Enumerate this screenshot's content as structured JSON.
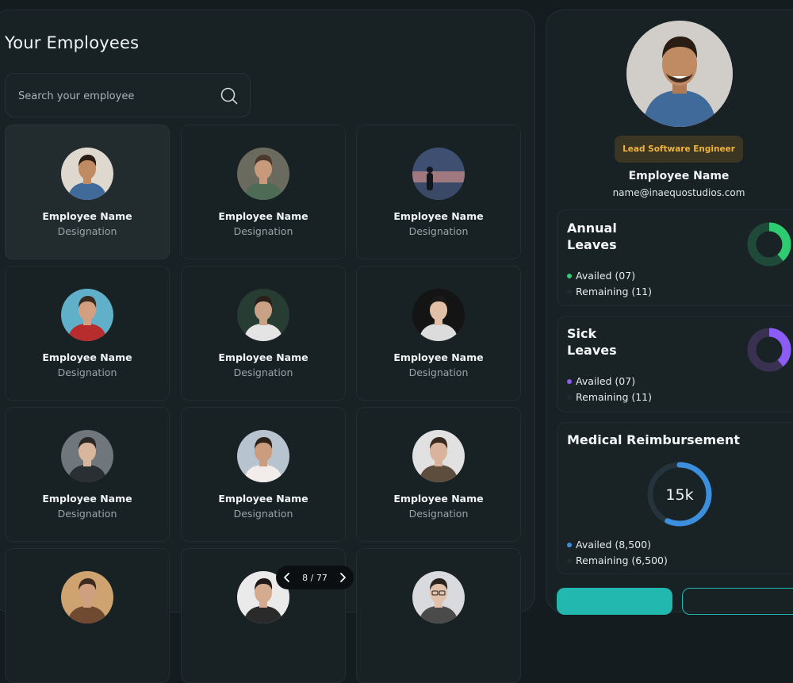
{
  "header": {
    "title": "Your Employees"
  },
  "search": {
    "placeholder": "Search your employee"
  },
  "employees": [
    {
      "name": "Employee Name",
      "designation": "Designation",
      "avatar": "person-smiling-icon"
    },
    {
      "name": "Employee Name",
      "designation": "Designation",
      "avatar": "person-icon"
    },
    {
      "name": "Employee Name",
      "designation": "Designation",
      "avatar": "silhouette-at-sunset-icon"
    },
    {
      "name": "Employee Name",
      "designation": "Designation",
      "avatar": "person-red-sweater-icon"
    },
    {
      "name": "Employee Name",
      "designation": "Designation",
      "avatar": "person-white-shirt-icon"
    },
    {
      "name": "Employee Name",
      "designation": "Designation",
      "avatar": "person-curly-hair-icon"
    },
    {
      "name": "Employee Name",
      "designation": "Designation",
      "avatar": "person-icon"
    },
    {
      "name": "Employee Name",
      "designation": "Designation",
      "avatar": "person-red-sleeves-icon"
    },
    {
      "name": "Employee Name",
      "designation": "Designation",
      "avatar": "person-scarf-icon"
    },
    {
      "name": "",
      "designation": "",
      "avatar": "person-icon"
    },
    {
      "name": "",
      "designation": "",
      "avatar": "person-icon"
    },
    {
      "name": "",
      "designation": "",
      "avatar": "person-glasses-icon"
    }
  ],
  "pagination": {
    "label": "8 / 77"
  },
  "profile": {
    "role": "Lead Software Engineer",
    "name": "Employee Name",
    "email": "name@inaequostudios.com",
    "avatar": "person-smiling-icon"
  },
  "annual": {
    "title_line1": "Annual",
    "title_line2": "Leaves",
    "availed": "Availed (07)",
    "remaining": "Remaining (11)",
    "availed_count": 7,
    "remaining_count": 11,
    "color": "#2ecc71",
    "track": "#1f4a3a"
  },
  "sick": {
    "title_line1": "Sick",
    "title_line2": "Leaves",
    "availed": "Availed (07)",
    "remaining": "Remaining (11)",
    "availed_count": 7,
    "remaining_count": 11,
    "color": "#8b5cf6",
    "track": "#3a3150"
  },
  "medical": {
    "title": "Medical Reimbursement",
    "value": "15k",
    "availed": "Availed (8,500)",
    "remaining": "Remaining (6,500)",
    "availed_amount": 8500,
    "remaining_amount": 6500,
    "color": "#3b8fdc",
    "track": "#24333c"
  },
  "colors": {
    "accent_teal": "#22b8b0",
    "badge_text": "#f1b43a",
    "badge_bg": "#3b3524"
  }
}
